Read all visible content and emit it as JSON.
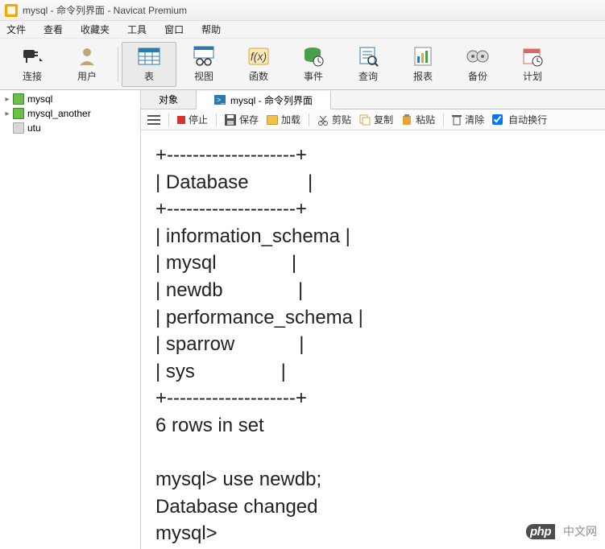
{
  "title": "mysql - 命令列界面 - Navicat Premium",
  "menu": [
    "文件",
    "查看",
    "收藏夹",
    "工具",
    "窗口",
    "帮助"
  ],
  "toolbar": [
    {
      "label": "连接",
      "icon": "plug"
    },
    {
      "label": "用户",
      "icon": "user"
    },
    {
      "label": "表",
      "icon": "table",
      "selected": true
    },
    {
      "label": "视图",
      "icon": "view"
    },
    {
      "label": "函数",
      "icon": "fx"
    },
    {
      "label": "事件",
      "icon": "event"
    },
    {
      "label": "查询",
      "icon": "query"
    },
    {
      "label": "报表",
      "icon": "report"
    },
    {
      "label": "备份",
      "icon": "backup"
    },
    {
      "label": "计划",
      "icon": "schedule"
    }
  ],
  "tree": [
    {
      "name": "mysql",
      "expandable": true,
      "cls": "db-ic"
    },
    {
      "name": "mysql_another",
      "expandable": true,
      "cls": "db-ic"
    },
    {
      "name": "utu",
      "expandable": false,
      "cls": "db-ic grey"
    }
  ],
  "tabs": [
    {
      "label": "对象",
      "active": false
    },
    {
      "label": "mysql - 命令列界面",
      "active": true,
      "icon": "cmd"
    }
  ],
  "subbar": {
    "stop": "停止",
    "save": "保存",
    "load": "加载",
    "cut": "剪贴",
    "copy": "复制",
    "paste": "粘贴",
    "clear": "清除",
    "wrap": "自动换行"
  },
  "terminal_lines": [
    "+--------------------+",
    "| Database           |",
    "+--------------------+",
    "| information_schema |",
    "| mysql              |",
    "| newdb              |",
    "| performance_schema |",
    "| sparrow            |",
    "| sys                |",
    "+--------------------+",
    "6 rows in set",
    "",
    "mysql> use newdb;",
    "Database changed",
    "mysql>"
  ],
  "watermark": {
    "php": "php",
    "cn": "中文网"
  }
}
